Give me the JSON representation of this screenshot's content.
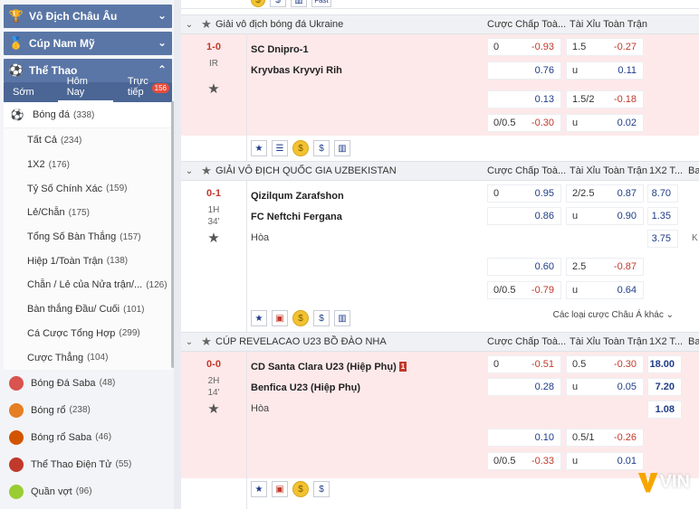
{
  "sidebar": {
    "sections": [
      {
        "label": "Vô Địch Châu Âu",
        "icon": "trophy-icon",
        "chevron": "⌄"
      },
      {
        "label": "Cúp Nam Mỹ",
        "icon": "cup-icon",
        "chevron": "⌄"
      },
      {
        "label": "Thể Thao",
        "icon": "sports-icon",
        "chevron": "⌃"
      }
    ],
    "tabs": [
      {
        "label": "Sớm"
      },
      {
        "label": "Hôm Nay"
      },
      {
        "label": "Trực tiếp",
        "badge": "156"
      }
    ],
    "football": {
      "label": "Bóng đá",
      "count": "(338)"
    },
    "sub_items": [
      {
        "label": "Tất Cả",
        "count": "(234)"
      },
      {
        "label": "1X2",
        "count": "(176)"
      },
      {
        "label": "Tỷ Số Chính Xác",
        "count": "(159)"
      },
      {
        "label": "Lẻ/Chẵn",
        "count": "(175)"
      },
      {
        "label": "Tổng Số Bàn Thắng",
        "count": "(157)"
      },
      {
        "label": "Hiệp 1/Toàn Trận",
        "count": "(138)"
      },
      {
        "label": "Chẵn / Lẻ của Nửa trận/...",
        "count": "(126)"
      },
      {
        "label": "Bàn thắng Đầu/ Cuối",
        "count": "(101)"
      },
      {
        "label": "Cá Cược Tổng Hợp",
        "count": "(299)"
      },
      {
        "label": "Cược Thẳng",
        "count": "(104)"
      }
    ],
    "other_sports": [
      {
        "label": "Bóng Đá Saba",
        "count": "(48)",
        "color": "#d9534f"
      },
      {
        "label": "Bóng rổ",
        "count": "(238)",
        "color": "#e67e22"
      },
      {
        "label": "Bóng rổ Saba",
        "count": "(46)",
        "color": "#d35400"
      },
      {
        "label": "Thể Thao Điện Tử",
        "count": "(55)",
        "color": "#c0392b"
      },
      {
        "label": "Quần vợt",
        "count": "(96)",
        "color": "#9acd32"
      }
    ]
  },
  "top_icons": {
    "fast_label": "Fast"
  },
  "columns": {
    "handicap": "Cược Chấp Toà...",
    "ou": "Tài Xỉu Toàn Trận",
    "x12": "1X2 T...",
    "extra": "Ba"
  },
  "leagues": [
    {
      "name": "Giải vô địch bóng đá Ukraine",
      "match": {
        "score": "1-0",
        "period": "IR",
        "period2": "",
        "home": "SC Dnipro-1",
        "away": "Kryvbas Kryvyi Rih",
        "draw": "",
        "rows": [
          {
            "hc": "0",
            "hc_val": "-0.93",
            "ou": "1.5",
            "ou_val": "-0.27"
          },
          {
            "hc": "",
            "hc_val": "0.76",
            "ou": "u",
            "ou_val": "0.11"
          },
          {
            "hc": "",
            "hc_val": "0.13",
            "ou": "1.5/2",
            "ou_val": "-0.18"
          },
          {
            "hc": "0/0.5",
            "hc_val": "-0.30",
            "ou": "u",
            "ou_val": "0.02"
          }
        ]
      }
    },
    {
      "name": "GIẢI VÔ ĐỊCH QUỐC GIA UZBEKISTAN",
      "match": {
        "score": "0-1",
        "period": "1H",
        "period2": "34'",
        "home": "Qizilqum Zarafshon",
        "away": "FC Neftchi Fergana",
        "draw": "Hòa",
        "rows": [
          {
            "hc": "0",
            "hc_val": "0.95",
            "ou": "2/2.5",
            "ou_val": "0.87",
            "x12": "8.70"
          },
          {
            "hc": "",
            "hc_val": "0.86",
            "ou": "u",
            "ou_val": "0.90",
            "x12": "1.35"
          },
          {
            "x12": "3.75",
            "extra": "K"
          },
          {
            "hc": "",
            "hc_val": "0.60",
            "ou": "2.5",
            "ou_val": "-0.87"
          },
          {
            "hc": "0/0.5",
            "hc_val": "-0.79",
            "ou": "u",
            "ou_val": "0.64"
          }
        ],
        "more": "Các loại cược Châu Á khác"
      }
    },
    {
      "name": "CÚP REVELACAO U23 BỒ ĐÀO NHA",
      "match": {
        "score": "0-0",
        "period": "2H",
        "period2": "14'",
        "home": "CD Santa Clara U23 (Hiệp Phụ)",
        "home_card": "1",
        "away": "Benfica U23 (Hiệp Phụ)",
        "draw": "Hòa",
        "rows": [
          {
            "hc": "0",
            "hc_val": "-0.51",
            "ou": "0.5",
            "ou_val": "-0.30",
            "x12": "18.00"
          },
          {
            "hc": "",
            "hc_val": "0.28",
            "ou": "u",
            "ou_val": "0.05",
            "x12": "7.20"
          },
          {
            "x12": "1.08"
          },
          {
            "hc": "",
            "hc_val": "0.10",
            "ou": "0.5/1",
            "ou_val": "-0.26"
          },
          {
            "hc": "0/0.5",
            "hc_val": "-0.33",
            "ou": "u",
            "ou_val": "0.01"
          }
        ]
      }
    }
  ],
  "watermark": "VIN"
}
